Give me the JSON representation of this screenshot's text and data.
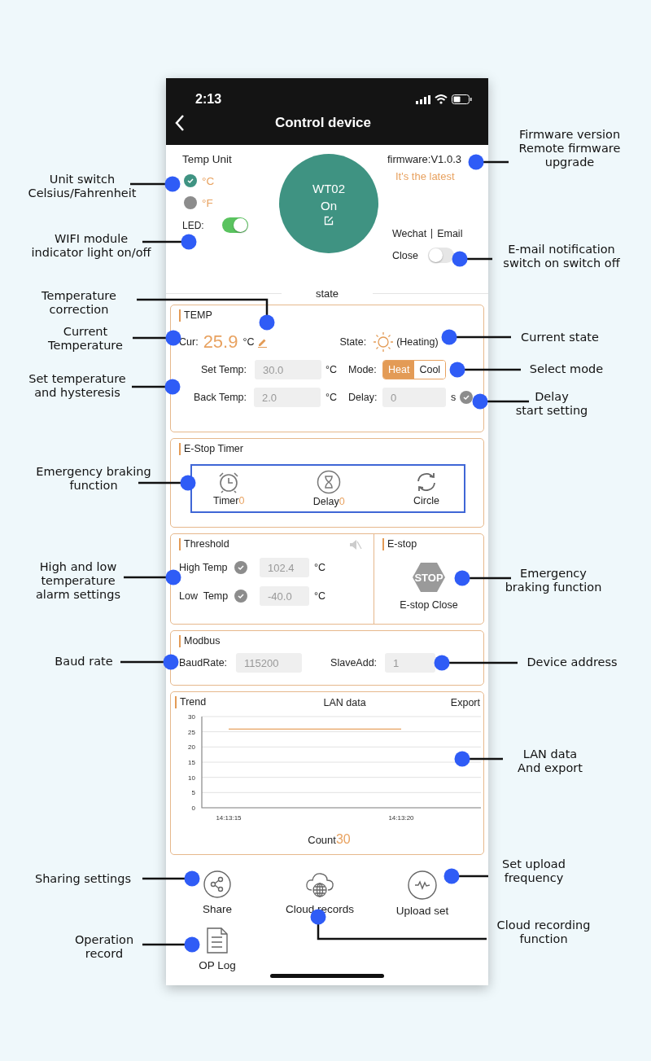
{
  "status_bar": {
    "time": "2:13"
  },
  "header": {
    "title": "Control device"
  },
  "device": {
    "temp_unit_label": "Temp Unit",
    "units": [
      {
        "label": "°C",
        "selected": true
      },
      {
        "label": "°F",
        "selected": false
      }
    ],
    "led": {
      "label": "LED:",
      "on": true
    },
    "name": "WT02",
    "power": "On",
    "firmware": "firmware:V1.0.3",
    "firmware_status": "It's the latest",
    "notify_channels": [
      "Wechat",
      "Email"
    ],
    "notify": {
      "label": "Close",
      "on": false
    }
  },
  "section_label": "state",
  "temp": {
    "title": "TEMP",
    "cur_label": "Cur:",
    "cur_value": "25.9",
    "cur_unit": "°C",
    "state_label": "State:",
    "state_value": "(Heating)",
    "set_label": "Set Temp:",
    "set_value": "30.0",
    "set_unit": "°C",
    "mode_label": "Mode:",
    "modes": [
      {
        "label": "Heat",
        "selected": true
      },
      {
        "label": "Cool",
        "selected": false
      }
    ],
    "back_label": "Back Temp:",
    "back_value": "2.0",
    "back_unit": "°C",
    "delay_label": "Delay:",
    "delay_value": "0",
    "delay_unit": "s"
  },
  "estop_timer": {
    "title": "E-Stop Timer",
    "items": [
      {
        "kind": "timer",
        "label": "Timer",
        "count": "0"
      },
      {
        "kind": "delay",
        "label": "Delay",
        "count": "0"
      },
      {
        "kind": "circle",
        "label": "Circle"
      }
    ]
  },
  "threshold": {
    "title": "Threshold",
    "rows": [
      {
        "label": "High Temp",
        "value": "102.4",
        "unit": "°C"
      },
      {
        "label": "Low  Temp",
        "value": "-40.0",
        "unit": "°C"
      }
    ]
  },
  "estop": {
    "title": "E-stop",
    "sign": "STOP",
    "status": "E-stop Close"
  },
  "modbus": {
    "title": "Modbus",
    "baud_label": "BaudRate:",
    "baud_value": "115200",
    "slave_label": "SlaveAdd:",
    "slave_value": "1"
  },
  "trend": {
    "title": "Trend",
    "center": "LAN data",
    "action": "Export",
    "count_label": "Count",
    "count_value": "30",
    "chart_data": {
      "type": "line",
      "x": [
        "14:13:15",
        "14:13:20"
      ],
      "series": [
        {
          "color": "#e8a260",
          "values": [
            25.9,
            25.9
          ]
        }
      ],
      "ylim": [
        0,
        30
      ],
      "yticks": [
        0,
        5,
        10,
        15,
        20,
        25,
        30
      ],
      "grid": true
    }
  },
  "actions": [
    {
      "kind": "share",
      "label": "Share"
    },
    {
      "kind": "cloud",
      "label": "Cloud records"
    },
    {
      "kind": "upload",
      "label": "Upload set"
    },
    {
      "kind": "log",
      "label": "OP Log"
    }
  ],
  "annotations": [
    {
      "text": "Unit switch\nCelsius/Fahrenheit"
    },
    {
      "text": "WIFI module\nindicator light on/off"
    },
    {
      "text": "Temperature\ncorrection"
    },
    {
      "text": "Current\nTemperature"
    },
    {
      "text": "Set temperature\nand hysteresis"
    },
    {
      "text": "Emergency braking\nfunction"
    },
    {
      "text": "High and low\ntemperature\nalarm settings"
    },
    {
      "text": "Baud rate"
    },
    {
      "text": "Sharing settings"
    },
    {
      "text": "Operation\nrecord"
    },
    {
      "text": "Firmware version\nRemote firmware\nupgrade"
    },
    {
      "text": "E-mail notification\nswitch on switch off"
    },
    {
      "text": "Current state"
    },
    {
      "text": "Select mode"
    },
    {
      "text": "Delay\nstart setting"
    },
    {
      "text": "Emergency\nbraking function"
    },
    {
      "text": "Device address"
    },
    {
      "text": "LAN data\nAnd export"
    },
    {
      "text": "Set upload\nfrequency"
    },
    {
      "text": "Cloud recording\nfunction"
    }
  ]
}
